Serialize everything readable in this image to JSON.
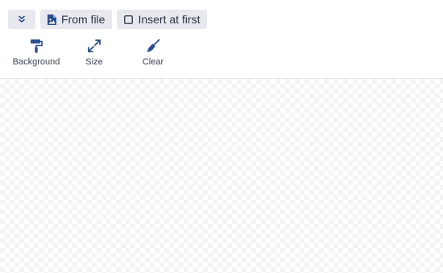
{
  "toolbar": {
    "collapse_icon": "double-chevron-down-icon",
    "from_file": {
      "label": "From file",
      "icon": "file-image-icon"
    },
    "insert_at_first": {
      "label": "Insert at first",
      "icon": "checkbox-icon",
      "checked": false
    },
    "tools": [
      {
        "label": "Background",
        "icon": "paint-roller-icon"
      },
      {
        "label": "Size",
        "icon": "expand-arrows-icon"
      },
      {
        "label": "Clear",
        "icon": "broom-icon"
      }
    ]
  },
  "colors": {
    "accent": "#2b4f8e",
    "button_bg": "#e7e9ee",
    "text": "#2a3340",
    "divider": "#e3e5e8"
  }
}
